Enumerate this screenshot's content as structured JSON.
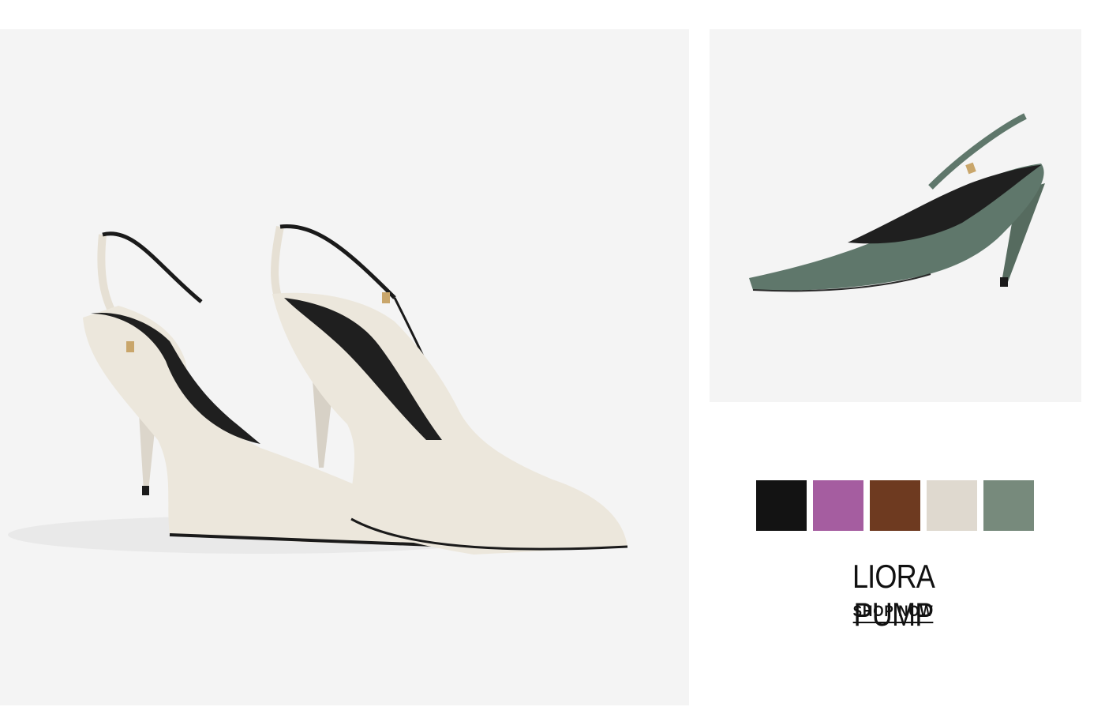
{
  "product": {
    "name": "LIORA PUMP",
    "cta_label": "SHOP NOW"
  },
  "swatches": [
    {
      "name": "black",
      "color": "#131313"
    },
    {
      "name": "purple",
      "color": "#a55da0"
    },
    {
      "name": "brown",
      "color": "#6e3a20"
    },
    {
      "name": "cream",
      "color": "#dfd9cf"
    },
    {
      "name": "sage",
      "color": "#778a7c"
    }
  ],
  "colors": {
    "hero_shoe": "#ece7dc",
    "thumb_shoe": "#5f776b",
    "background": "#f4f4f4"
  }
}
